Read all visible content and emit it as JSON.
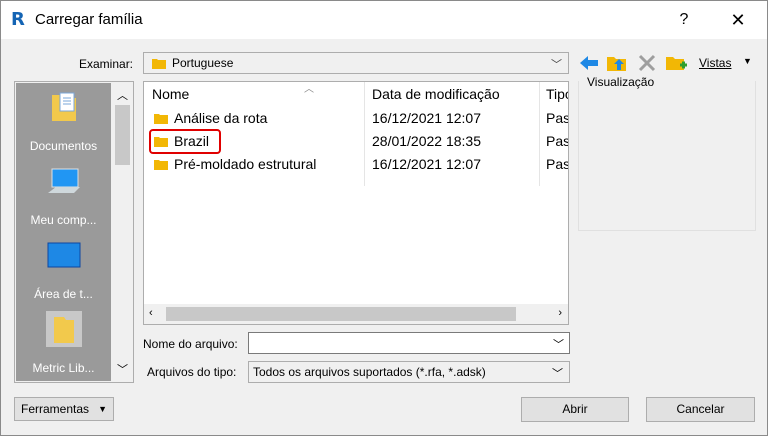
{
  "window": {
    "title": "Carregar família",
    "app_icon": "R",
    "help": "?",
    "close": "✕"
  },
  "toolbar": {
    "lookin_label": "Examinar:",
    "lookin_value": "Portuguese",
    "views_label": "Vistas",
    "icons": [
      "back-arrow-icon",
      "up-folder-icon",
      "delete-icon",
      "new-folder-icon"
    ],
    "colors": {
      "back_arrow": "#1e88e5",
      "folder": "#f2b705",
      "new_folder_plus": "#2e9e2e"
    }
  },
  "places": [
    {
      "label": "Documentos",
      "icon": "documents-icon"
    },
    {
      "label": "Meu comp...",
      "icon": "computer-icon"
    },
    {
      "label": "Área de t...",
      "icon": "desktop-icon"
    },
    {
      "label": "Metric Lib...",
      "icon": "folder-icon",
      "selected": true
    }
  ],
  "filelist": {
    "columns": [
      "Nome",
      "Data de modificação",
      "Tipo"
    ],
    "rows": [
      {
        "name": "Análise da rota",
        "date": "16/12/2021 12:07",
        "type": "Past"
      },
      {
        "name": "Brazil",
        "date": "28/01/2022 18:35",
        "type": "Past",
        "highlighted": true
      },
      {
        "name": "Pré-moldado estrutural",
        "date": "16/12/2021 12:07",
        "type": "Past"
      }
    ]
  },
  "preview": {
    "label": "Visualização"
  },
  "fields": {
    "filename_label": "Nome do arquivo:",
    "filename_value": "",
    "filetype_label": "Arquivos do tipo:",
    "filetype_value": "Todos os arquivos suportados  (*.rfa, *.adsk)"
  },
  "buttons": {
    "tools": "Ferramentas",
    "open": "Abrir",
    "cancel": "Cancelar"
  }
}
